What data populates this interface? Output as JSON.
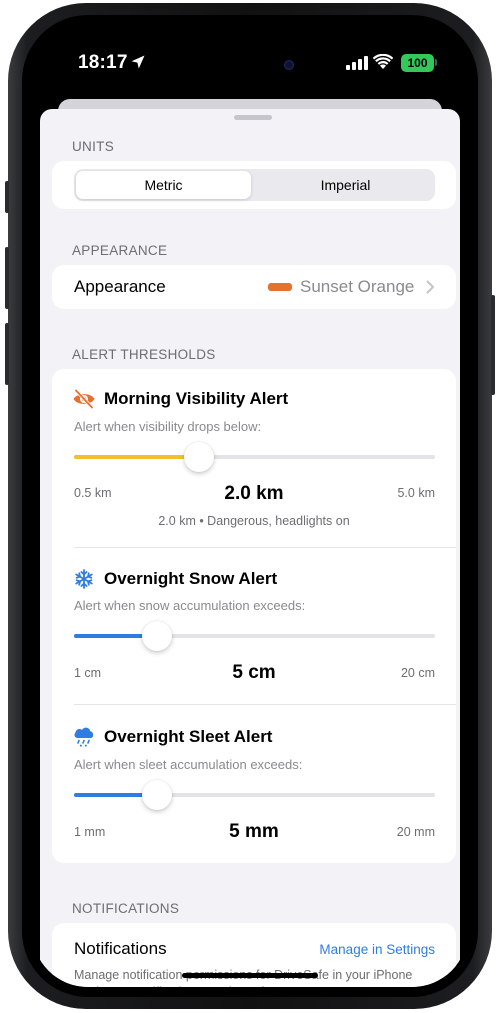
{
  "status_bar": {
    "time": "18:17",
    "battery": "100"
  },
  "units": {
    "header": "UNITS",
    "options": [
      "Metric",
      "Imperial"
    ],
    "selected": "Metric"
  },
  "appearance": {
    "header": "APPEARANCE",
    "label": "Appearance",
    "value": "Sunset Orange",
    "swatch_color": "#e8702f"
  },
  "alert_thresholds": {
    "header": "ALERT THRESHOLDS",
    "alerts": [
      {
        "title": "Morning Visibility Alert",
        "icon": "eye-slash-icon",
        "description": "Alert when visibility drops below:",
        "min": "0.5 km",
        "max": "5.0 km",
        "value": "2.0 km",
        "fraction": 0.345,
        "note": "2.0 km • Dangerous, headlights on",
        "color": "#f2c02f"
      },
      {
        "title": "Overnight Snow Alert",
        "icon": "snowflake-icon",
        "description": "Alert when snow accumulation exceeds:",
        "min": "1 cm",
        "max": "20 cm",
        "value": "5 cm",
        "fraction": 0.23,
        "color": "#2f7de1"
      },
      {
        "title": "Overnight Sleet Alert",
        "icon": "sleet-cloud-icon",
        "description": "Alert when sleet accumulation exceeds:",
        "min": "1 mm",
        "max": "20 mm",
        "value": "5 mm",
        "fraction": 0.23,
        "color": "#2f7de1"
      }
    ]
  },
  "notifications": {
    "header": "NOTIFICATIONS",
    "title": "Notifications",
    "link": "Manage in Settings",
    "description": "Manage notification permissions for DriveSafe in your iPhone Settings > Notifications > DriveSafe"
  }
}
